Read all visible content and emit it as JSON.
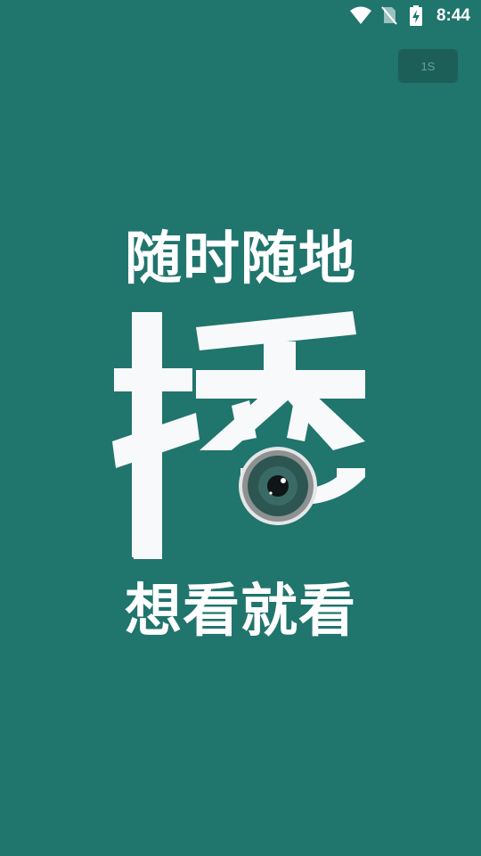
{
  "status_bar": {
    "time": "8:44",
    "icons": [
      "wifi-icon",
      "no-sim-icon",
      "battery-charging-icon"
    ]
  },
  "skip_button": {
    "label": "1S"
  },
  "splash": {
    "tagline_top": "随时随地",
    "tagline_bottom": "想看就看",
    "logo_icon": "bo-character-camera-logo"
  },
  "colors": {
    "background": "#20756d",
    "skip_button_bg": "#1b5f58",
    "text": "#ffffff"
  }
}
